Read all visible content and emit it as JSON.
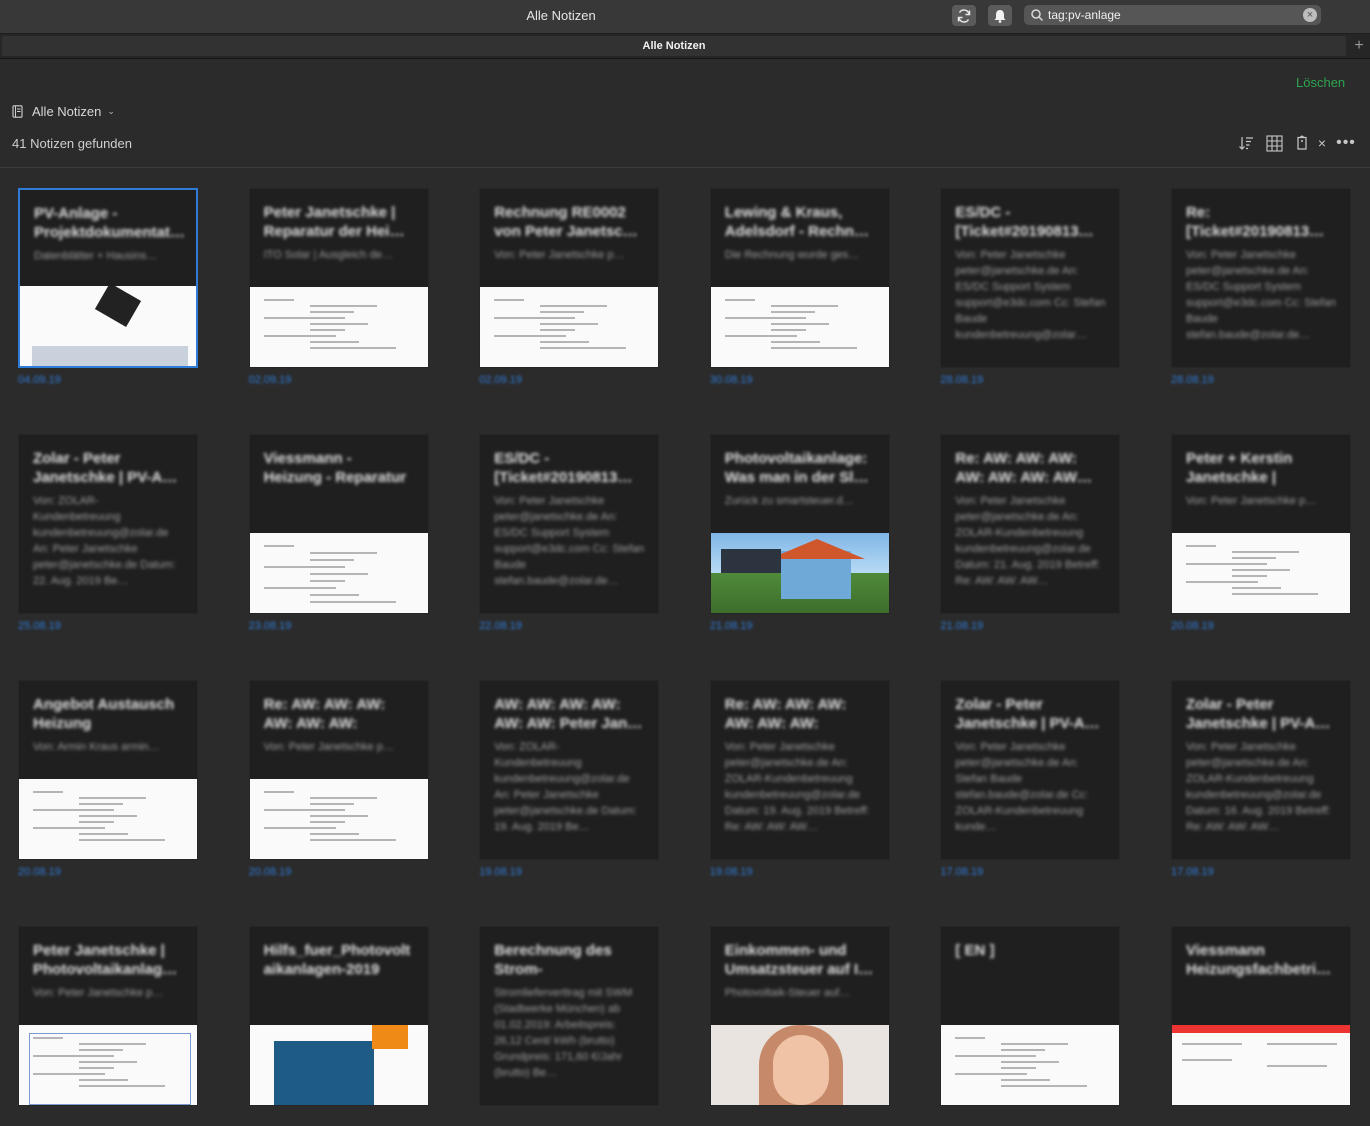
{
  "window": {
    "title": "Alle Notizen"
  },
  "toolbar": {
    "sync_icon": "sync-icon",
    "bell_icon": "bell-icon"
  },
  "search": {
    "value": "tag:pv-anlage",
    "icon": "search-icon"
  },
  "tabs": [
    {
      "label": "Alle Notizen"
    }
  ],
  "header": {
    "delete_label": "Löschen",
    "notebook_label": "Alle Notizen",
    "count_text": "41 Notizen gefunden"
  },
  "colors": {
    "accent": "#2f7bd8",
    "delete": "#2ea44f",
    "background": "#2b2b2b"
  },
  "notes": [
    {
      "title": "PV-Anlage - Projektdokumentat…",
      "snippet": "Datenblätter + Hausins…",
      "date": "04.09.19",
      "thumb": "photo-wb",
      "selected": true
    },
    {
      "title": "Peter Janetschke | Reparatur der Hei…",
      "snippet": "ITO Solar | Ausgleich de…",
      "date": "02.09.19",
      "thumb": "doc"
    },
    {
      "title": "Rechnung RE0002 von Peter Janetsc…",
      "snippet": "Von: Peter Janetschke p…",
      "date": "02.09.19",
      "thumb": "doc"
    },
    {
      "title": "Lewing & Kraus, Adelsdorf - Rechn…",
      "snippet": "Die Rechnung wurde ges…",
      "date": "30.08.19",
      "thumb": "doc"
    },
    {
      "title": "ES/DC - [Ticket#20190813…",
      "snippet": "Von: Peter Janetschke peter@janetschke.de An: ES/DC Support System support@e3dc.com Cc: Stefan Baude kundenbetreuung@zolar…",
      "date": "28.08.19",
      "thumb": "none"
    },
    {
      "title": "Re: [Ticket#20190813…",
      "snippet": "Von: Peter Janetschke peter@janetschke.de An: ES/DC Support System support@e3dc.com Cc: Stefan Baude stefan.baude@zolar.de…",
      "date": "28.08.19",
      "thumb": "none"
    },
    {
      "title": "Zolar - Peter Janetschke | PV-A…",
      "snippet": "Von: ZOLAR-Kundenbetreuung kundenbetreuung@zolar.de An: Peter Janetschke peter@janetschke.de Datum: 22. Aug. 2019 Be…",
      "date": "25.08.19",
      "thumb": "none"
    },
    {
      "title": "Viessmann - Heizung - Reparatur",
      "snippet": "",
      "date": "23.08.19",
      "thumb": "sheet"
    },
    {
      "title": "ES/DC - [Ticket#20190813…",
      "snippet": "Von: Peter Janetschke peter@janetschke.de An: ES/DC Support System support@e3dc.com Cc: Stefan Baude stefan.baude@zolar.de…",
      "date": "22.08.19",
      "thumb": "none"
    },
    {
      "title": "Photovoltaikanlage: Was man in der Sl…",
      "snippet": "Zurück zu smartsteuer.d…",
      "date": "21.08.19",
      "thumb": "house"
    },
    {
      "title": "Re: AW: AW: AW: AW: AW: AW: AW…",
      "snippet": "Von: Peter Janetschke peter@janetschke.de An: ZOLAR-Kundenbetreuung kundenbetreuung@zolar.de Datum: 21. Aug. 2019 Betreff: Re: AW: AW: AW…",
      "date": "21.08.19",
      "thumb": "none"
    },
    {
      "title": "Peter + Kerstin Janetschke | Beste…",
      "snippet": "Von: Peter Janetschke p…",
      "date": "20.08.19",
      "thumb": "doc"
    },
    {
      "title": "Angebot Austausch Heizung",
      "snippet": "Von: Armin Kraus armin…",
      "date": "20.08.19",
      "thumb": "doc"
    },
    {
      "title": "Re: AW: AW: AW: AW: AW: AW: Peter…",
      "snippet": "Von: Peter Janetschke p…",
      "date": "20.08.19",
      "thumb": "doc"
    },
    {
      "title": "AW: AW: AW: AW: AW: AW: Peter Jan…",
      "snippet": "Von: ZOLAR-Kundenbetreuung kundenbetreuung@zolar.de An: Peter Janetschke peter@janetschke.de Datum: 19. Aug. 2019 Be…",
      "date": "19.08.19",
      "thumb": "none"
    },
    {
      "title": "Re: AW: AW: AW: AW: AW: AW: Peter…",
      "snippet": "Von: Peter Janetschke peter@janetschke.de An: ZOLAR-Kundenbetreuung kundenbetreuung@zolar.de Datum: 19. Aug. 2019 Betreff: Re: AW: AW: AW…",
      "date": "19.08.19",
      "thumb": "none"
    },
    {
      "title": "Zolar - Peter Janetschke | PV-A…",
      "snippet": "Von: Peter Janetschke peter@janetschke.de An: Stefan Baude stefan.baude@zolar.de Cc: ZOLAR-Kundenbetreuung kunde…",
      "date": "17.08.19",
      "thumb": "none"
    },
    {
      "title": "Zolar - Peter Janetschke | PV-A…",
      "snippet": "Von: Peter Janetschke peter@janetschke.de An: ZOLAR-Kundenbetreuung kundenbetreuung@zolar.de Datum: 16. Aug. 2019 Betreff: Re: AW: AW: AW…",
      "date": "17.08.19",
      "thumb": "none"
    },
    {
      "title": "Peter Janetschke | Photovoltaikanlag…",
      "snippet": "Von: Peter Janetschke p…",
      "date": "",
      "thumb": "form"
    },
    {
      "title": "Hilfs_fuer_Photovolt aikanlagen-2019",
      "snippet": "",
      "date": "",
      "thumb": "brochure"
    },
    {
      "title": "Berechnung des Strom-Eigenverbra…",
      "snippet": "Stromlieferverttrag mit SWM (Stadtwerke München) ab 01.02.2019: Arbeitspreis: 26,12 Cent/ kWh (brutto) Grundpreis: 171,60 €/Jahr (brutto) Be…",
      "date": "",
      "thumb": "none"
    },
    {
      "title": "Einkommen- und Umsatzsteuer auf I…",
      "snippet": "Photovoltaik-Steuer auf…",
      "date": "",
      "thumb": "face"
    },
    {
      "title": "[ EN ]",
      "snippet": "",
      "date": "",
      "thumb": "doc"
    },
    {
      "title": "Viessmann Heizungsfachbetri…",
      "snippet": "",
      "date": "",
      "thumb": "web"
    }
  ]
}
